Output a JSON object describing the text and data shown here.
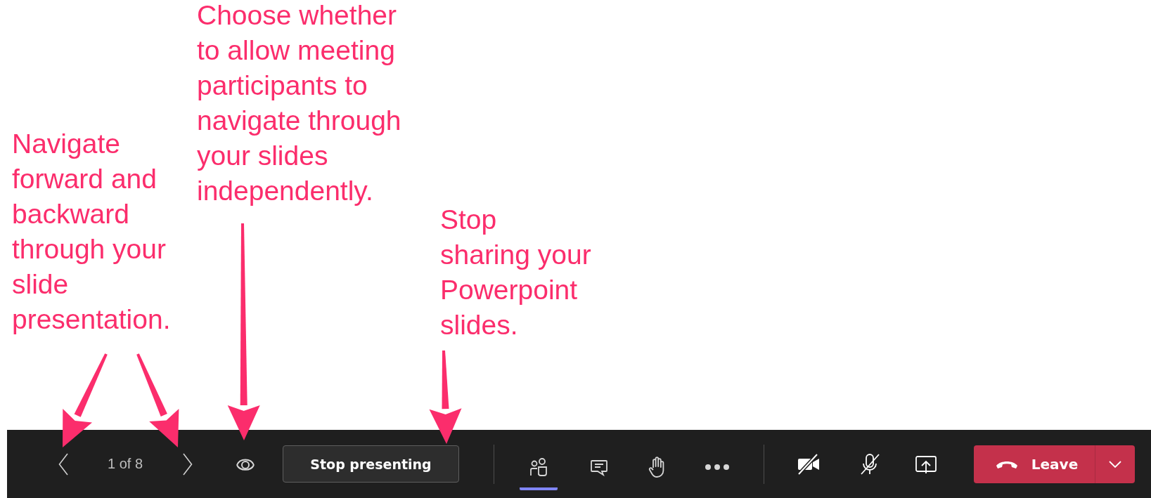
{
  "annotations": [
    {
      "text": "Navigate forward and backward through your slide presentation."
    },
    {
      "text": "Choose whether to allow meeting participants to navigate through your slides independently."
    },
    {
      "text": "Stop sharing your Powerpoint slides."
    }
  ],
  "toolbar": {
    "slide_counter": "1 of 8",
    "stop_button": "Stop presenting",
    "meeting_controls": [
      {
        "kind": "people",
        "selected": true
      },
      {
        "kind": "chat",
        "selected": false
      },
      {
        "kind": "hand",
        "selected": false
      },
      {
        "kind": "more",
        "selected": false
      }
    ],
    "device_controls": [
      {
        "kind": "camera",
        "off": true
      },
      {
        "kind": "mic",
        "off": true
      },
      {
        "kind": "share"
      }
    ],
    "leave_button": "Leave"
  }
}
